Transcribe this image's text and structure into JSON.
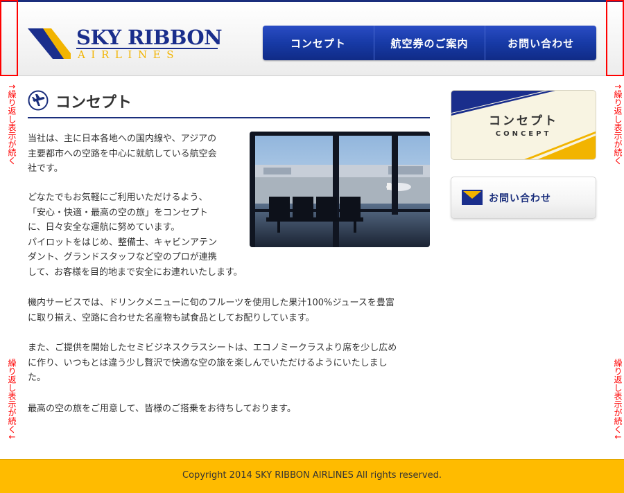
{
  "brand": {
    "name": "SKY RIBBON",
    "sub": "AIRLINES"
  },
  "nav": [
    {
      "label": "コンセプト"
    },
    {
      "label": "航空券のご案内"
    },
    {
      "label": "お問い合わせ"
    }
  ],
  "annotations": {
    "repeat_note": "繰り返し表示が続く",
    "arrow_up": "↑",
    "arrow_down": "↓"
  },
  "page": {
    "title": "コンセプト"
  },
  "content": {
    "paragraphs": [
      [
        "当社は、主に日本各地への国内線や、アジアの",
        "主要都市への空路を中心に就航している航空会",
        "社です。"
      ],
      [
        "どなたでもお気軽にご利用いただけるよう、",
        "「安心・快適・最高の空の旅」をコンセプト",
        "に、日々安全な運航に努めています。",
        "パイロットをはじめ、整備士、キャビンアテン",
        "ダント、グランドスタッフなど空のプロが連携",
        "して、お客様を目的地まで安全にお連れいたします。"
      ],
      [
        "機内サービスでは、ドリンクメニューに旬のフルーツを使用した果汁100%ジュースを豊富",
        "に取り揃え、空路に合わせた名産物も試食品としてお配りしています。"
      ],
      [
        "また、ご提供を開始したセミビジネスクラスシートは、エコノミークラスより席を少し広め",
        "に作り、いつもとは違う少し贅沢で快適な空の旅を楽しんでいただけるようにいたしまし",
        "た。"
      ],
      [
        "最高の空の旅をご用意して、皆様のご搭乗をお待ちしております。"
      ]
    ]
  },
  "sidebar": {
    "concept_title": "コンセプト",
    "concept_sub": "CONCEPT",
    "contact_label": "お問い合わせ"
  },
  "footer": {
    "copyright": "Copyright 2014 SKY RIBBON AIRLINES All rights reserved."
  },
  "colors": {
    "brand_navy": "#1a2e7c",
    "accent_yellow": "#ffbb00",
    "annotation_red": "#ff0000"
  }
}
